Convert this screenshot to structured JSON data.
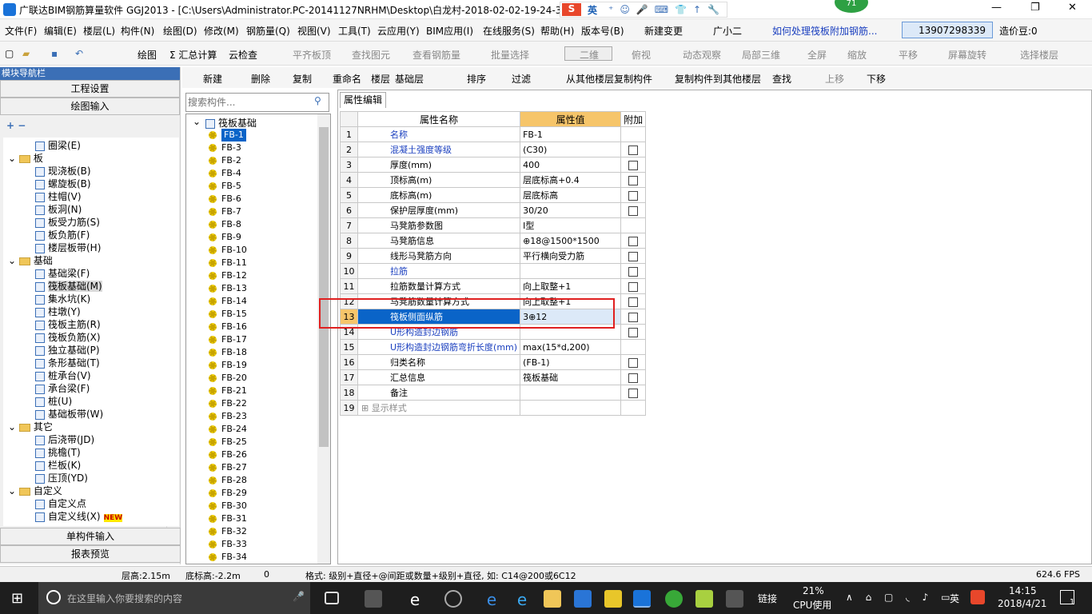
{
  "title": "广联达BIM钢筋算量软件 GGJ2013 - [C:\\Users\\Administrator.PC-20141127NRHM\\Desktop\\白龙村-2018-02-02-19-24-35",
  "window_controls": {
    "minimize": "—",
    "maximize": "❐",
    "close": "✕"
  },
  "overlay_badge": "71",
  "ime_bar": {
    "s": "S",
    "lang": "英"
  },
  "menu": [
    "文件(F)",
    "编辑(E)",
    "楼层(L)",
    "构件(N)",
    "绘图(D)",
    "修改(M)",
    "钢筋量(Q)",
    "视图(V)",
    "工具(T)",
    "云应用(Y)",
    "BIM应用(I)",
    "在线服务(S)",
    "帮助(H)",
    "版本号(B)",
    "新建变更",
    "广小二",
    "如何处理筏板附加钢筋...",
    "13907298339",
    "造价豆:0"
  ],
  "toolbar1": [
    "绘图",
    "Σ 汇总计算",
    "云检查",
    "平齐板顶",
    "查找图元",
    "查看钢筋量",
    "批量选择",
    "二维",
    "俯视",
    "动态观察",
    "局部三维",
    "全屏",
    "缩放",
    "平移",
    "屏幕旋转",
    "选择楼层"
  ],
  "toolbar2": [
    "新建",
    "删除",
    "复制",
    "重命名",
    "楼层",
    "基础层",
    "排序",
    "过滤",
    "从其他楼层复制构件",
    "复制构件到其他楼层",
    "查找",
    "上移",
    "下移"
  ],
  "left_panel": {
    "title": "模块导航栏",
    "buttons": [
      "工程设置",
      "绘图输入"
    ],
    "bottom_buttons": [
      "单构件输入",
      "报表预览"
    ],
    "tree": [
      {
        "label": "圈梁(E)",
        "level": 2
      },
      {
        "label": "板",
        "level": 1
      },
      {
        "label": "现浇板(B)",
        "level": 2
      },
      {
        "label": "螺旋板(B)",
        "level": 2
      },
      {
        "label": "柱帽(V)",
        "level": 2
      },
      {
        "label": "板洞(N)",
        "level": 2
      },
      {
        "label": "板受力筋(S)",
        "level": 2
      },
      {
        "label": "板负筋(F)",
        "level": 2
      },
      {
        "label": "楼层板带(H)",
        "level": 2
      },
      {
        "label": "基础",
        "level": 1
      },
      {
        "label": "基础梁(F)",
        "level": 2
      },
      {
        "label": "筏板基础(M)",
        "level": 2
      },
      {
        "label": "集水坑(K)",
        "level": 2
      },
      {
        "label": "柱墩(Y)",
        "level": 2
      },
      {
        "label": "筏板主筋(R)",
        "level": 2
      },
      {
        "label": "筏板负筋(X)",
        "level": 2
      },
      {
        "label": "独立基础(P)",
        "level": 2
      },
      {
        "label": "条形基础(T)",
        "level": 2
      },
      {
        "label": "桩承台(V)",
        "level": 2
      },
      {
        "label": "承台梁(F)",
        "level": 2
      },
      {
        "label": "桩(U)",
        "level": 2
      },
      {
        "label": "基础板带(W)",
        "level": 2
      },
      {
        "label": "其它",
        "level": 1
      },
      {
        "label": "后浇带(JD)",
        "level": 2
      },
      {
        "label": "挑檐(T)",
        "level": 2
      },
      {
        "label": "栏板(K)",
        "level": 2
      },
      {
        "label": "压顶(YD)",
        "level": 2
      },
      {
        "label": "自定义",
        "level": 1
      },
      {
        "label": "自定义点",
        "level": 2
      },
      {
        "label": "自定义线(X)",
        "level": 2
      }
    ],
    "new_badge": "NEW"
  },
  "mid_panel": {
    "search_placeholder": "搜索构件...",
    "root": "筏板基础",
    "items": [
      "FB-1",
      "FB-3",
      "FB-2",
      "FB-4",
      "FB-5",
      "FB-6",
      "FB-7",
      "FB-8",
      "FB-9",
      "FB-10",
      "FB-11",
      "FB-12",
      "FB-13",
      "FB-14",
      "FB-15",
      "FB-16",
      "FB-17",
      "FB-18",
      "FB-19",
      "FB-20",
      "FB-21",
      "FB-22",
      "FB-23",
      "FB-24",
      "FB-25",
      "FB-26",
      "FB-27",
      "FB-28",
      "FB-29",
      "FB-30",
      "FB-31",
      "FB-32",
      "FB-33",
      "FB-34"
    ]
  },
  "prop": {
    "tab": "属性编辑",
    "headers": [
      "属性名称",
      "属性值",
      "附加"
    ],
    "rows": [
      {
        "n": "1",
        "name": "名称",
        "value": "FB-1",
        "blue": true,
        "cb": false
      },
      {
        "n": "2",
        "name": "混凝土强度等级",
        "value": "(C30)",
        "blue": true,
        "cb": true
      },
      {
        "n": "3",
        "name": "厚度(mm)",
        "value": "400",
        "blue": false,
        "cb": true
      },
      {
        "n": "4",
        "name": "顶标高(m)",
        "value": "层底标高+0.4",
        "blue": false,
        "cb": true
      },
      {
        "n": "5",
        "name": "底标高(m)",
        "value": "层底标高",
        "blue": false,
        "cb": true
      },
      {
        "n": "6",
        "name": "保护层厚度(mm)",
        "value": "30/20",
        "blue": false,
        "cb": true
      },
      {
        "n": "7",
        "name": "马凳筋参数图",
        "value": "Ⅰ型",
        "blue": false,
        "cb": false
      },
      {
        "n": "8",
        "name": "马凳筋信息",
        "value": "⊕18@1500*1500",
        "blue": false,
        "cb": true
      },
      {
        "n": "9",
        "name": "线形马凳筋方向",
        "value": "平行横向受力筋",
        "blue": false,
        "cb": true
      },
      {
        "n": "10",
        "name": "拉筋",
        "value": "",
        "blue": true,
        "cb": true
      },
      {
        "n": "11",
        "name": "拉筋数量计算方式",
        "value": "向上取整+1",
        "blue": false,
        "cb": true
      },
      {
        "n": "12",
        "name": "马凳筋数量计算方式",
        "value": "向上取整+1",
        "blue": false,
        "cb": true
      },
      {
        "n": "13",
        "name": "筏板侧面纵筋",
        "value": "3⊕12",
        "blue": false,
        "cb": true,
        "selected": true
      },
      {
        "n": "14",
        "name": "U形构造封边钢筋",
        "value": "",
        "blue": true,
        "cb": true
      },
      {
        "n": "15",
        "name": "U形构造封边钢筋弯折长度(mm)",
        "value": "max(15*d,200)",
        "blue": true,
        "cb": false
      },
      {
        "n": "16",
        "name": "归类名称",
        "value": "(FB-1)",
        "blue": false,
        "cb": true
      },
      {
        "n": "17",
        "name": "汇总信息",
        "value": "筏板基础",
        "blue": false,
        "cb": true
      },
      {
        "n": "18",
        "name": "备注",
        "value": "",
        "blue": false,
        "cb": true
      },
      {
        "n": "19",
        "name": "显示样式",
        "value": "",
        "blue": false,
        "cb": false,
        "plus": true
      }
    ]
  },
  "status": {
    "floor_height": "层高:2.15m",
    "base_elev": "底标高:-2.2m",
    "zero": "0",
    "format": "格式: 级别+直径+@间距或数量+级别+直径, 如: C14@200或6C12",
    "fps": "624.6 FPS"
  },
  "taskbar": {
    "search": "在这里输入你要搜索的内容",
    "link": "链接",
    "cpu_pct": "21%",
    "cpu_label": "CPU使用",
    "lang": "英",
    "time": "14:15",
    "date": "2018/4/21",
    "notif": "1"
  },
  "colors": {
    "accent": "#3b6fb6",
    "selected_row": "#0a64c8",
    "highlight_box": "#e02020",
    "value_header": "#f6c56a"
  }
}
